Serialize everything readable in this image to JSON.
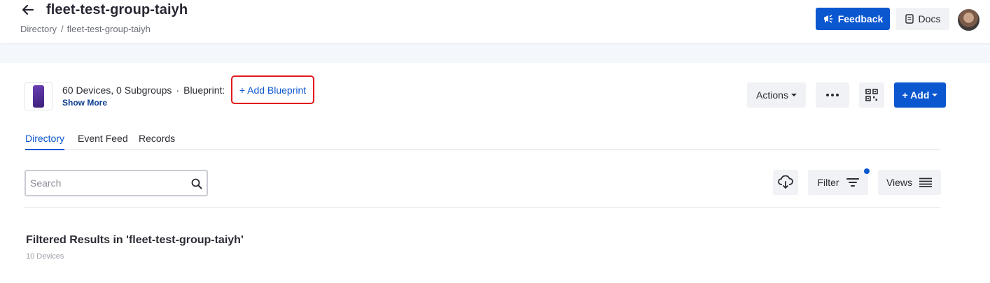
{
  "header": {
    "title": "fleet-test-group-taiyh",
    "breadcrumb": [
      "Directory",
      "fleet-test-group-taiyh"
    ],
    "breadcrumb_sep": "/",
    "feedback_label": "Feedback",
    "docs_label": "Docs",
    "icons": {
      "back": "arrow-left-icon",
      "feedback": "megaphone-icon",
      "docs": "book-icon"
    }
  },
  "group": {
    "summary_counts": "60 Devices, 0 Subgroups",
    "separator": "·",
    "blueprint_label": "Blueprint:",
    "add_blueprint_label": "+ Add Blueprint",
    "show_more_label": "Show More",
    "highlight_color": "#e0191d"
  },
  "toolbar": {
    "actions_label": "Actions",
    "add_label": "+ Add",
    "icons": {
      "more": "ellipsis-icon",
      "qr": "qr-code-icon",
      "caret": "caret-down-icon"
    }
  },
  "tabs": [
    {
      "label": "Directory",
      "active": true
    },
    {
      "label": "Event Feed",
      "active": false
    },
    {
      "label": "Records",
      "active": false
    }
  ],
  "filters": {
    "search_placeholder": "Search",
    "search_value": "",
    "filter_label": "Filter",
    "views_label": "Views",
    "filter_active": true,
    "icons": {
      "search": "search-icon",
      "download": "cloud-download-icon",
      "filter": "filter-icon",
      "views": "list-icon"
    }
  },
  "results": {
    "title": "Filtered Results in 'fleet-test-group-taiyh'",
    "count": "10 Devices"
  },
  "colors": {
    "accent": "#0b57d0",
    "button_bg": "#f1f2f5",
    "band_bg": "#f4f7fc"
  }
}
